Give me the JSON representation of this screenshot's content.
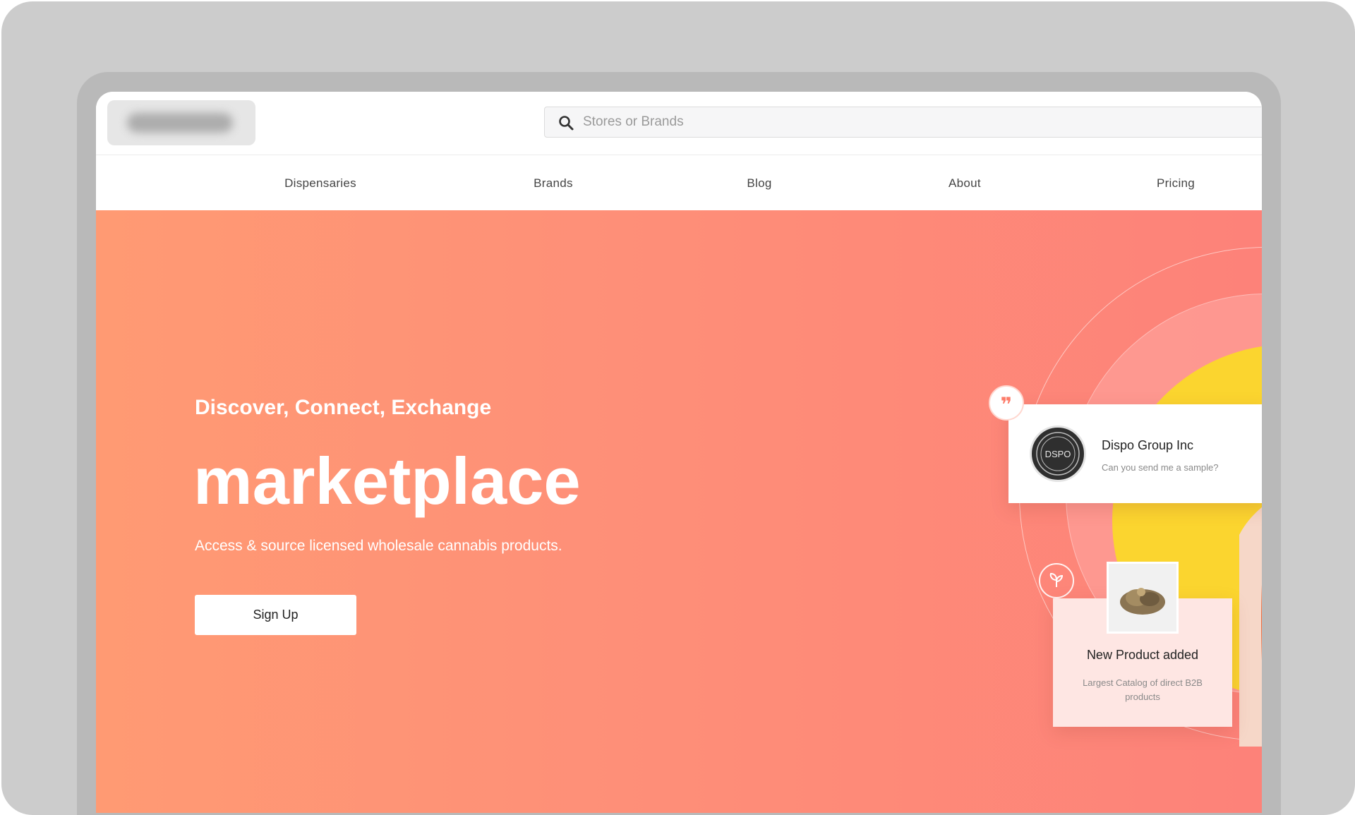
{
  "header": {
    "search": {
      "placeholder": "Stores or Brands"
    },
    "nav": [
      {
        "label": "Dispensaries"
      },
      {
        "label": "Brands"
      },
      {
        "label": "Blog"
      },
      {
        "label": "About"
      },
      {
        "label": "Pricing"
      }
    ]
  },
  "hero": {
    "kicker": "Discover, Connect, Exchange",
    "title": "marketplace",
    "subtitle": "Access & source licensed wholesale cannabis products.",
    "cta_label": "Sign Up"
  },
  "chat_card": {
    "name": "Dispo Group Inc",
    "message": "Can you send me a sample?",
    "avatar_text": "DSPO"
  },
  "product_card": {
    "title": "New Product added",
    "description": "Largest Catalog of direct B2B products"
  },
  "icons": {
    "quote": "quote-icon",
    "leaf": "leaf-icon",
    "search": "search-icon"
  },
  "colors": {
    "hero_start": "#ff9a73",
    "hero_end": "#fd8279",
    "accent_yellow": "#fbd52f"
  }
}
